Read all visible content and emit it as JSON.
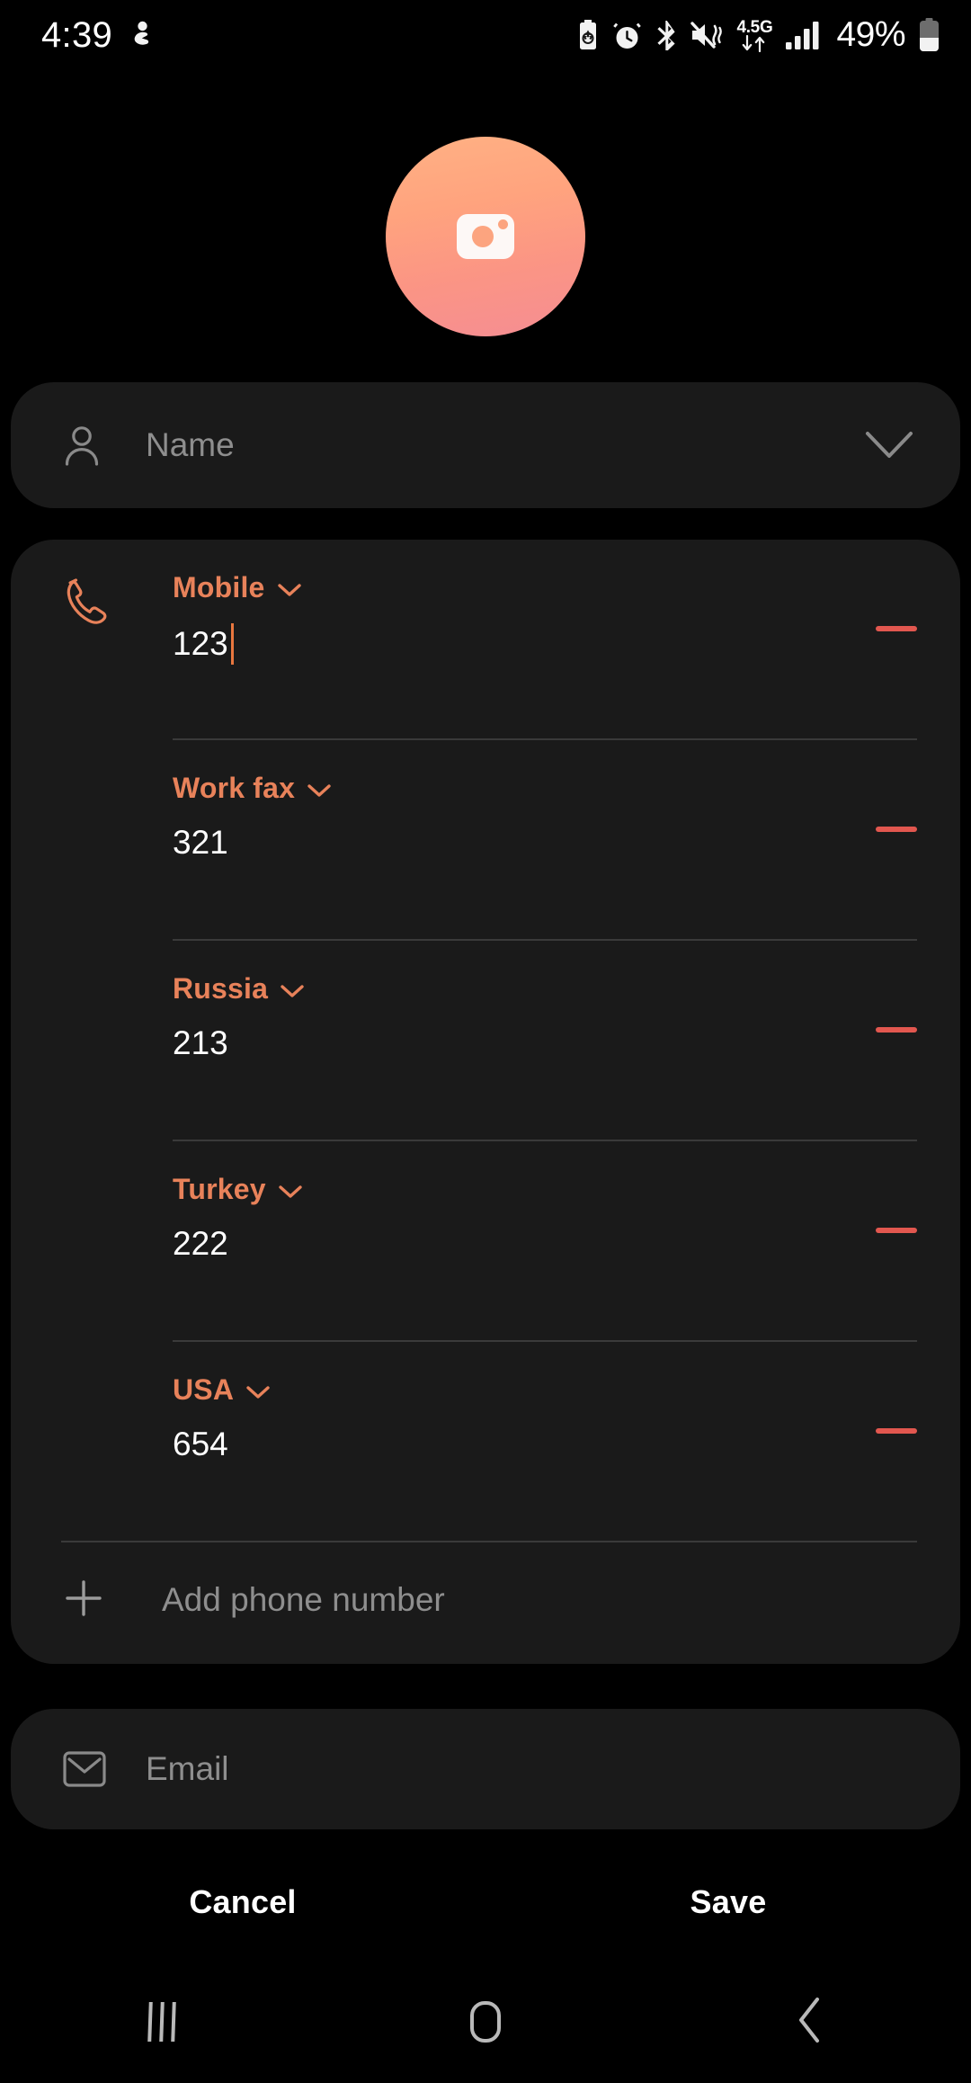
{
  "status_bar": {
    "time": "4:39",
    "left_icons": [
      "person-activity-icon"
    ],
    "right_icons": [
      "battery-saver-icon",
      "alarm-icon",
      "bluetooth-icon",
      "mute-vibrate-icon",
      "mobile-data-icon",
      "signal-bars-icon"
    ],
    "network_type": "4.5G",
    "battery_percent": "49%"
  },
  "avatar": {
    "icon": "camera-icon",
    "gradient_from": "#ffb184",
    "gradient_to": "#f58d93"
  },
  "name_field": {
    "icon": "person-icon",
    "placeholder": "Name",
    "expand_icon": "chevron-down-icon"
  },
  "phone_section": {
    "icon": "phone-handset-icon",
    "entries": [
      {
        "label": "Mobile",
        "value": "123",
        "has_caret": true,
        "remove_label": "remove"
      },
      {
        "label": "Work fax",
        "value": "321",
        "has_caret": false,
        "remove_label": "remove"
      },
      {
        "label": "Russia",
        "value": "213",
        "has_caret": false,
        "remove_label": "remove"
      },
      {
        "label": "Turkey",
        "value": "222",
        "has_caret": false,
        "remove_label": "remove"
      },
      {
        "label": "USA",
        "value": "654",
        "has_caret": false,
        "remove_label": "remove"
      }
    ],
    "add_label": "Add phone number",
    "add_icon": "plus-icon",
    "accent_color": "#e8825a",
    "remove_color": "#e2574f"
  },
  "email_field": {
    "icon": "envelope-icon",
    "placeholder": "Email"
  },
  "actions": {
    "cancel_label": "Cancel",
    "save_label": "Save"
  },
  "nav_bar": {
    "recents_label": "recents-icon",
    "home_label": "home-icon",
    "back_label": "back-icon"
  }
}
